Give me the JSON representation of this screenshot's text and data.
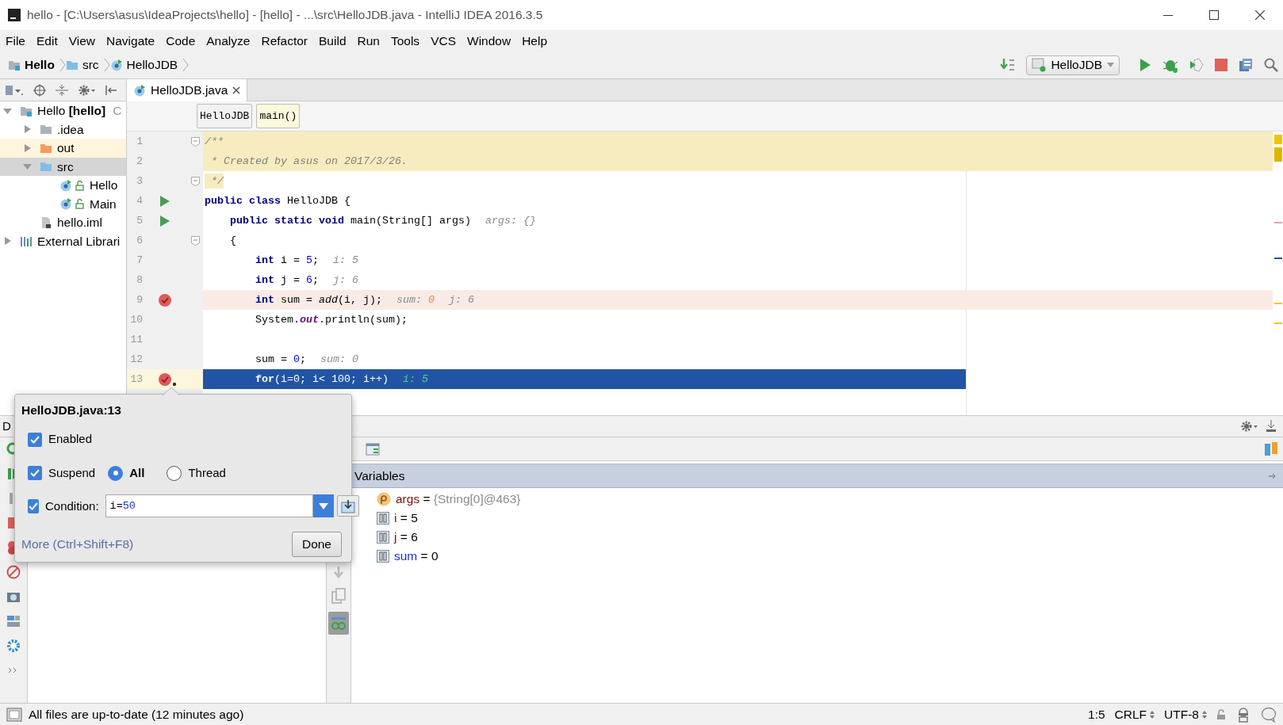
{
  "window": {
    "title": "hello - [C:\\Users\\asus\\IdeaProjects\\hello] - [hello] - ...\\src\\HelloJDB.java - IntelliJ IDEA 2016.3.5"
  },
  "menu": [
    "File",
    "Edit",
    "View",
    "Navigate",
    "Code",
    "Analyze",
    "Refactor",
    "Build",
    "Run",
    "Tools",
    "VCS",
    "Window",
    "Help"
  ],
  "breadcrumb": [
    {
      "label": "Hello",
      "kind": "module"
    },
    {
      "label": "src",
      "kind": "source_folder"
    },
    {
      "label": "HelloJDB",
      "kind": "class"
    }
  ],
  "run_config": {
    "label": "HelloJDB"
  },
  "project_tree": [
    {
      "label": "Hello **[hello]**",
      "path": "C",
      "kind": "module",
      "expanded": true,
      "selected": false,
      "children": [
        {
          "label": ".idea",
          "kind": "folder",
          "expanded": false,
          "selected": false
        },
        {
          "label": "out",
          "kind": "excluded_folder",
          "expanded": false,
          "selected": false
        },
        {
          "label": "src",
          "kind": "source_folder",
          "expanded": true,
          "selected": true,
          "children": [
            {
              "label": "Hello",
              "kind": "class",
              "selected": false
            },
            {
              "label": "Main",
              "kind": "class",
              "selected": false
            }
          ]
        },
        {
          "label": "hello.iml",
          "kind": "file",
          "selected": false
        }
      ]
    },
    {
      "label": "External Librari",
      "kind": "library",
      "expanded": false,
      "selected": false
    }
  ],
  "editor": {
    "tabs": [
      {
        "label": "HelloJDB.java",
        "selected": true
      }
    ],
    "crumbs": [
      {
        "label": "HelloJDB",
        "selected": false
      },
      {
        "label": "main()",
        "selected": true
      }
    ],
    "lines": [
      {
        "number": "1",
        "fold": true,
        "kind": "doc",
        "tokens": [
          {
            "t": "/**",
            "kind": "comment"
          }
        ]
      },
      {
        "number": "2",
        "kind": "doc",
        "tokens": [
          {
            "t": " * Created by asus on 2017/3/26.",
            "kind": "comment"
          }
        ]
      },
      {
        "number": "3",
        "fold": true,
        "kind": "doc_partial",
        "tokens": [
          {
            "t": " */",
            "kind": "comment"
          }
        ]
      },
      {
        "number": "4",
        "marker": {
          "kind": "run"
        },
        "tokens": [
          {
            "t": "public class",
            "kind": "keyword"
          },
          {
            "t": " HelloJDB {",
            "kind": "plain"
          }
        ]
      },
      {
        "number": "5",
        "marker": {
          "kind": "run"
        },
        "tokens": [
          {
            "t": "    public static void",
            "kind": "keyword"
          },
          {
            "t": " main(String[] args)",
            "kind": "plain"
          }
        ],
        "hints": [
          {
            "label": "args:",
            "value": "{}",
            "changed": false
          }
        ]
      },
      {
        "number": "6",
        "fold": true,
        "tokens": [
          {
            "t": "    {",
            "kind": "plain"
          }
        ]
      },
      {
        "number": "7",
        "tokens": [
          {
            "t": "        int",
            "kind": "keyword"
          },
          {
            "t": " i = ",
            "kind": "plain"
          },
          {
            "t": "5",
            "kind": "number"
          },
          {
            "t": ";",
            "kind": "plain"
          }
        ],
        "hints": [
          {
            "label": "i:",
            "value": "5",
            "changed": false
          }
        ]
      },
      {
        "number": "8",
        "tokens": [
          {
            "t": "        int",
            "kind": "keyword"
          },
          {
            "t": " j = ",
            "kind": "plain"
          },
          {
            "t": "6",
            "kind": "number"
          },
          {
            "t": ";",
            "kind": "plain"
          }
        ],
        "hints": [
          {
            "label": "j:",
            "value": "6",
            "changed": false
          }
        ]
      },
      {
        "number": "9",
        "marker": {
          "kind": "breakpoint"
        },
        "kind": "breakpoint",
        "tokens": [
          {
            "t": "        int",
            "kind": "keyword"
          },
          {
            "t": " sum = ",
            "kind": "plain"
          },
          {
            "t": "add",
            "kind": "call"
          },
          {
            "t": "(i, j);",
            "kind": "plain"
          }
        ],
        "hints": [
          {
            "label": "sum:",
            "value": "0",
            "changed": true
          },
          {
            "label": "j:",
            "value": "6",
            "changed": false
          }
        ]
      },
      {
        "number": "10",
        "tokens": [
          {
            "t": "        System.",
            "kind": "plain"
          },
          {
            "t": "out",
            "kind": "field"
          },
          {
            "t": ".println(sum);",
            "kind": "plain"
          }
        ]
      },
      {
        "number": "11"
      },
      {
        "number": "12",
        "tokens": [
          {
            "t": "        sum = ",
            "kind": "plain"
          },
          {
            "t": "0",
            "kind": "number"
          },
          {
            "t": ";",
            "kind": "plain"
          }
        ],
        "hints": [
          {
            "label": "sum:",
            "value": "0",
            "changed": false
          }
        ]
      },
      {
        "number": "13",
        "marker": {
          "kind": "conditional_breakpoint"
        },
        "kind": "current",
        "tokens": [
          {
            "t": "        for",
            "kind": "keyword"
          },
          {
            "t": "(i=0; i< 100; i++)",
            "kind": "plain"
          }
        ],
        "hints": [
          {
            "label": "i:",
            "value": "5",
            "changed": false
          }
        ]
      }
    ]
  },
  "breakpoint_popup": {
    "title": "HelloJDB.java:13",
    "enabled": {
      "label": "Enabled",
      "checked": true
    },
    "suspend": {
      "label": "Suspend",
      "checked": true
    },
    "suspend_options": [
      {
        "label": "All",
        "selected": true
      },
      {
        "label": "Thread",
        "selected": false
      }
    ],
    "condition": {
      "label": "Condition:",
      "checked": true,
      "value": "i=50"
    },
    "more_link": "More (Ctrl+Shift+F8)",
    "done_button": "Done"
  },
  "debug": {
    "title": "D",
    "variables_title": "Variables",
    "variables": [
      {
        "kind": "parameter",
        "name": "args",
        "operator": "=",
        "value": "{String[0]@463}",
        "changed": false
      },
      {
        "kind": "local",
        "name": "i",
        "operator": "=",
        "value": "5",
        "changed": false
      },
      {
        "kind": "local",
        "name": "j",
        "operator": "=",
        "value": "6",
        "changed": false
      },
      {
        "kind": "local",
        "name": "sum",
        "operator": "=",
        "value": "0",
        "changed": true
      }
    ]
  },
  "status_bar": {
    "message": "All files are up-to-date (12 minutes ago)",
    "position": "1:5",
    "line_separator": "CRLF",
    "encoding": "UTF-8"
  }
}
